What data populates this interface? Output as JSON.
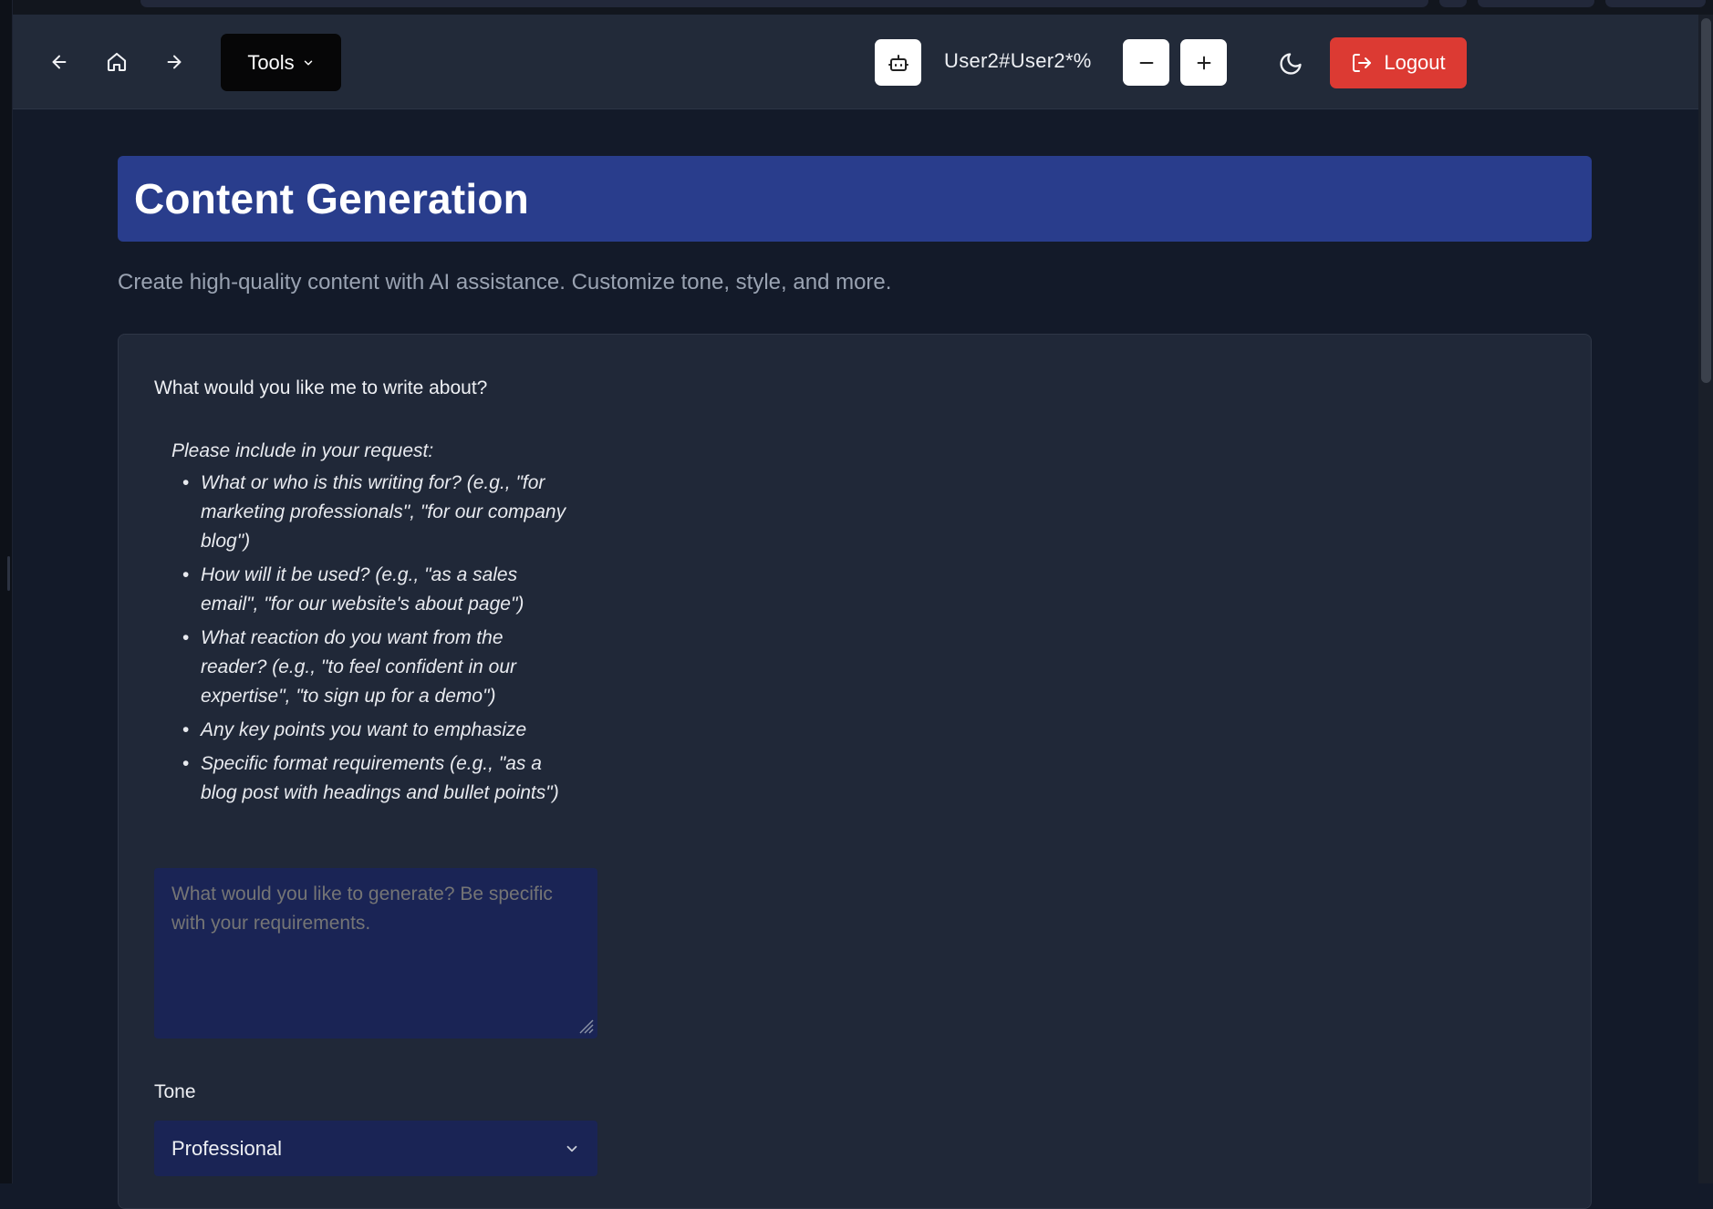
{
  "nav": {
    "back_icon": "arrow-left-icon",
    "home_icon": "home-icon",
    "forward_icon": "arrow-right-icon",
    "tools_label": "Tools",
    "bot_icon": "bot-icon",
    "username": "User2#User2*%",
    "zoom_out_icon": "minus-icon",
    "zoom_in_icon": "plus-icon",
    "theme_icon": "moon-icon",
    "logout_label": "Logout"
  },
  "page": {
    "title": "Content Generation",
    "subtitle": "Create high-quality content with AI assistance. Customize tone, style, and more."
  },
  "form": {
    "prompt_label": "What would you like me to write about?",
    "instructions_heading": "Please include in your request:",
    "instructions": [
      "What or who is this writing for? (e.g., \"for marketing professionals\", \"for our company blog\")",
      "How will it be used? (e.g., \"as a sales email\", \"for our website's about page\")",
      "What reaction do you want from the reader? (e.g., \"to feel confident in our expertise\", \"to sign up for a demo\")",
      "Any key points you want to emphasize",
      "Specific format requirements (e.g., \"as a blog post with headings and bullet points\")"
    ],
    "prompt_placeholder": "What would you like to generate? Be specific with your requirements.",
    "prompt_value": "",
    "tone_label": "Tone",
    "tone_value": "Professional"
  },
  "colors": {
    "header_band": "#293d8c",
    "logout": "#dc3a33",
    "input_bg": "#1a2455"
  }
}
